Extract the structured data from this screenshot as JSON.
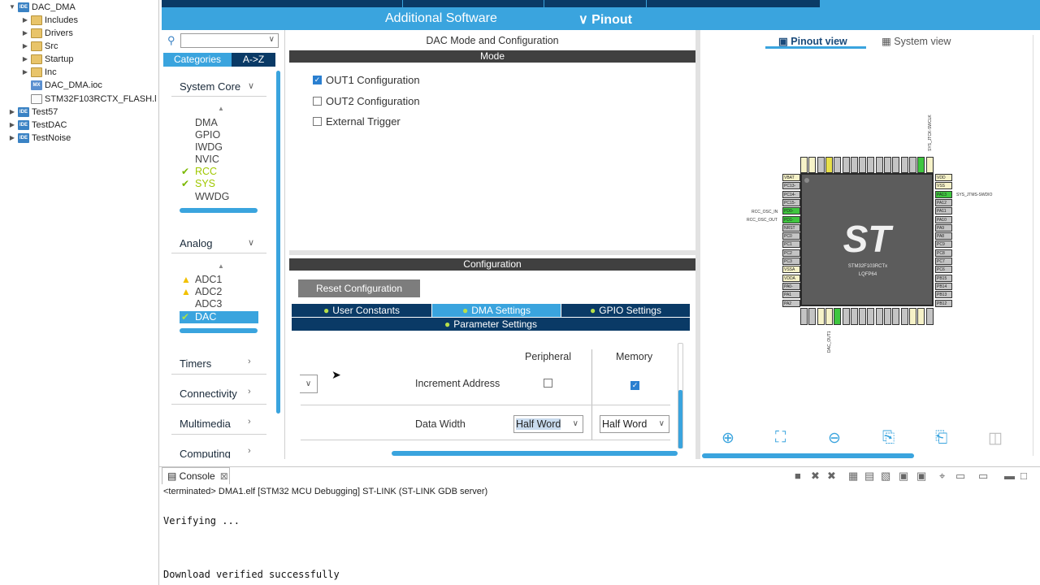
{
  "explorer": {
    "items": [
      {
        "label": "DAC_DMA",
        "icon": "IDE",
        "twisty": "▼",
        "depth": 0
      },
      {
        "label": "Includes",
        "icon": "folder",
        "twisty": "▶",
        "depth": 1
      },
      {
        "label": "Drivers",
        "icon": "folder",
        "twisty": "▶",
        "depth": 1
      },
      {
        "label": "Src",
        "icon": "folder",
        "twisty": "▶",
        "depth": 1
      },
      {
        "label": "Startup",
        "icon": "folder",
        "twisty": "▶",
        "depth": 1
      },
      {
        "label": "Inc",
        "icon": "folder",
        "twisty": "▶",
        "depth": 1
      },
      {
        "label": "DAC_DMA.ioc",
        "icon": "MX",
        "twisty": "",
        "depth": 1
      },
      {
        "label": "STM32F103RCTX_FLASH.l",
        "icon": "file",
        "twisty": "",
        "depth": 1
      },
      {
        "label": "Test57",
        "icon": "IDE",
        "twisty": "▶",
        "depth": 0
      },
      {
        "label": "TestDAC",
        "icon": "IDE",
        "twisty": "▶",
        "depth": 0
      },
      {
        "label": "TestNoise",
        "icon": "IDE",
        "twisty": "▶",
        "depth": 0
      }
    ]
  },
  "topbar": {
    "additional_software": "Additional Software",
    "pinout": "Pinout",
    "pinout_chevron": "∨"
  },
  "categories": {
    "tab_categories": "Categories",
    "tab_az": "A->Z",
    "groups": {
      "system_core": {
        "label": "System Core",
        "items": [
          "DMA",
          "GPIO",
          "IWDG",
          "NVIC",
          "RCC",
          "SYS",
          "WWDG"
        ]
      },
      "analog": {
        "label": "Analog",
        "items": [
          "ADC1",
          "ADC2",
          "ADC3",
          "DAC"
        ]
      },
      "timers": {
        "label": "Timers"
      },
      "connectivity": {
        "label": "Connectivity"
      },
      "multimedia": {
        "label": "Multimedia"
      },
      "computing": {
        "label": "Computing"
      }
    }
  },
  "mode": {
    "title": "DAC Mode and Configuration",
    "bar": "Mode",
    "options": [
      {
        "label": "OUT1 Configuration",
        "checked": true
      },
      {
        "label": "OUT2 Configuration",
        "checked": false
      },
      {
        "label": "External Trigger",
        "checked": false
      }
    ]
  },
  "config": {
    "bar": "Configuration",
    "reset": "Reset Configuration",
    "tabs": [
      "User Constants",
      "DMA Settings",
      "GPIO Settings",
      "Parameter Settings"
    ],
    "active_tab": "DMA Settings",
    "col_peripheral": "Peripheral",
    "col_memory": "Memory",
    "row_increment": "Increment Address",
    "increment_peripheral": false,
    "increment_memory": true,
    "row_width": "Data Width",
    "width_peripheral": "Half Word",
    "width_memory": "Half Word"
  },
  "pinout": {
    "tab_pinout": "Pinout view",
    "tab_system": "System view",
    "chip_name": "STM32F103RCTx",
    "chip_package": "LQFP64",
    "logo": "ST",
    "labels": {
      "jtck": "SYS_JTCK-SWCLK",
      "jtms": "SYS_JTMS-SWDIO",
      "osc_in": "RCC_OSC_IN",
      "osc_out": "RCC_OSC_OUT",
      "dac_out1": "DAC_OUT1"
    },
    "left_pins": [
      "VBAT",
      "PC13-",
      "PC14-",
      "PC15-",
      "PD0-",
      "PD1-",
      "NRST",
      "PC0",
      "PC1",
      "PC2",
      "PC3",
      "VSSA",
      "VDDA",
      "PA0-",
      "PA1",
      "PA2"
    ],
    "right_pins": [
      "VDD",
      "VSS",
      "PA13",
      "PA12",
      "PA11",
      "PA10",
      "PA9",
      "PA8",
      "PC9",
      "PC8",
      "PC7",
      "PC6",
      "PB15",
      "PB14",
      "PB13",
      "PB12"
    ]
  },
  "console": {
    "tab_label": "Console",
    "status": "<terminated> DMA1.elf [STM32 MCU Debugging] ST-LINK (ST-LINK GDB server)",
    "lines": [
      "Verifying ...",
      "Download verified successfully"
    ]
  },
  "colors": {
    "accent": "#3aa4de",
    "navy": "#0a3a66",
    "dark_bar": "#404040",
    "pin_green": "#3fc63f"
  }
}
